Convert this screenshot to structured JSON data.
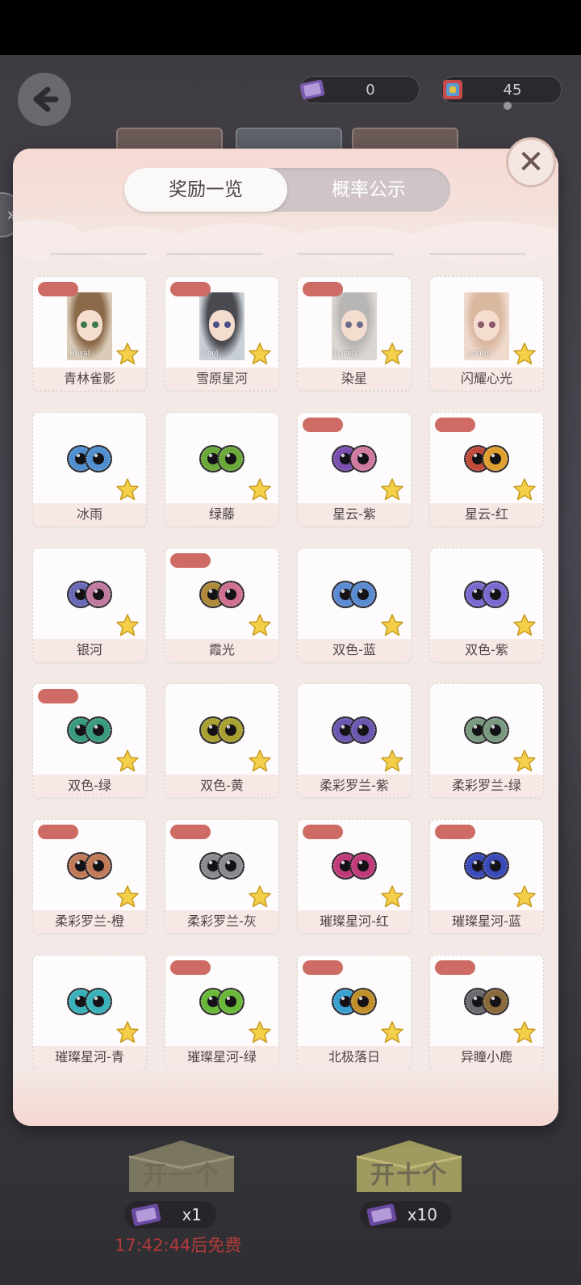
{
  "header": {
    "currency": [
      {
        "icon": "gift-ticket-icon",
        "value": "0"
      },
      {
        "icon": "crystal-box-icon",
        "value": "45"
      }
    ]
  },
  "modal": {
    "tabs": [
      {
        "label": "奖励一览",
        "active": true
      },
      {
        "label": "概率公示",
        "active": false
      }
    ],
    "close_icon": "close-icon",
    "items": [
      {
        "name": "青林雀影",
        "kind": "portrait",
        "tagged": true,
        "hair": "#8b6a4a",
        "bg": "#d9cbb7",
        "eye": "#3c7a4a",
        "caption": "Royal"
      },
      {
        "name": "雪原星河",
        "kind": "portrait",
        "tagged": true,
        "hair": "#4a4a50",
        "bg": "#c9cfd6",
        "eye": "#4a4e8a",
        "caption": "Cool"
      },
      {
        "name": "染星",
        "kind": "portrait",
        "tagged": true,
        "hair": "#b8b6b4",
        "bg": "#dcd6d2",
        "eye": "#6a6c8a",
        "caption": "Lovely"
      },
      {
        "name": "闪耀心光",
        "kind": "portrait",
        "tagged": false,
        "hair": "#d9b8a0",
        "bg": "#efd9cd",
        "eye": "#8a5a6a",
        "caption": "Lovely"
      },
      {
        "name": "冰雨",
        "kind": "lens",
        "tagged": false,
        "c1": "#4f8fd0",
        "c2": "#4f8fd0"
      },
      {
        "name": "绿藤",
        "kind": "lens",
        "tagged": false,
        "c1": "#6aa83a",
        "c2": "#6aa83a"
      },
      {
        "name": "星云-紫",
        "kind": "lens",
        "tagged": true,
        "c1": "#7a4fb0",
        "c2": "#d07aa0"
      },
      {
        "name": "星云-红",
        "kind": "lens",
        "tagged": true,
        "c1": "#c04a3a",
        "c2": "#e0a030"
      },
      {
        "name": "银河",
        "kind": "lens",
        "tagged": false,
        "c1": "#6a6ab8",
        "c2": "#c07aa0"
      },
      {
        "name": "霞光",
        "kind": "lens",
        "tagged": true,
        "c1": "#b08a3a",
        "c2": "#d07090"
      },
      {
        "name": "双色-蓝",
        "kind": "lens",
        "tagged": false,
        "c1": "#5a8ad0",
        "c2": "#5a8ad0"
      },
      {
        "name": "双色-紫",
        "kind": "lens",
        "tagged": false,
        "c1": "#7a6ad0",
        "c2": "#7a6ad0"
      },
      {
        "name": "双色-绿",
        "kind": "lens",
        "tagged": true,
        "c1": "#3a9a80",
        "c2": "#3a9a80"
      },
      {
        "name": "双色-黄",
        "kind": "lens",
        "tagged": false,
        "c1": "#a8a030",
        "c2": "#a8a030"
      },
      {
        "name": "柔彩罗兰-紫",
        "kind": "lens",
        "tagged": false,
        "c1": "#6a58b0",
        "c2": "#6a58b0"
      },
      {
        "name": "柔彩罗兰-绿",
        "kind": "lens",
        "tagged": false,
        "c1": "#7a9a80",
        "c2": "#7a9a80"
      },
      {
        "name": "柔彩罗兰-橙",
        "kind": "lens",
        "tagged": true,
        "c1": "#c07a58",
        "c2": "#c07a58"
      },
      {
        "name": "柔彩罗兰-灰",
        "kind": "lens",
        "tagged": true,
        "c1": "#8a8a90",
        "c2": "#8a8a90"
      },
      {
        "name": "璀璨星河-红",
        "kind": "lens",
        "tagged": true,
        "c1": "#c03a7a",
        "c2": "#c03a7a"
      },
      {
        "name": "璀璨星河-蓝",
        "kind": "lens",
        "tagged": true,
        "c1": "#3a4ab8",
        "c2": "#3a4ab8"
      },
      {
        "name": "璀璨星河-青",
        "kind": "lens",
        "tagged": false,
        "c1": "#3ab0b8",
        "c2": "#3ab0b8"
      },
      {
        "name": "璀璨星河-绿",
        "kind": "lens",
        "tagged": true,
        "c1": "#6ab83a",
        "c2": "#6ab83a"
      },
      {
        "name": "北极落日",
        "kind": "lens",
        "tagged": true,
        "c1": "#3aa0d0",
        "c2": "#c0902a"
      },
      {
        "name": "异瞳小鹿",
        "kind": "lens",
        "tagged": true,
        "c1": "#6a6a70",
        "c2": "#8a6a3a"
      }
    ]
  },
  "footer": {
    "open_one": {
      "label": "开一个",
      "cost": "x1"
    },
    "open_ten": {
      "label": "开十个",
      "cost": "x10"
    },
    "timer": "17:42:44后免费"
  }
}
